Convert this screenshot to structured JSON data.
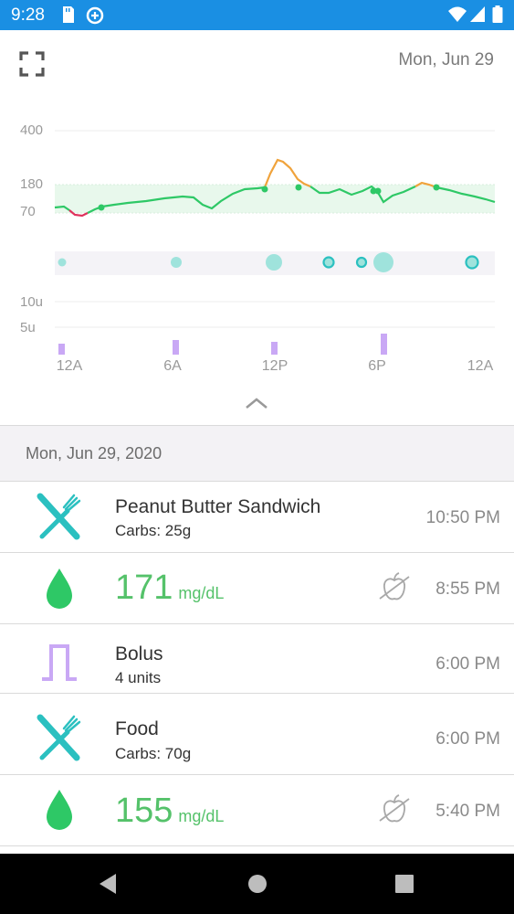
{
  "status_bar": {
    "time": "9:28",
    "icons": [
      "sd-card-icon",
      "data-saver-icon",
      "wifi-icon",
      "signal-icon",
      "battery-icon"
    ]
  },
  "header": {
    "date": "Mon, Jun 29",
    "fullscreen_icon": "fullscreen-icon"
  },
  "chart": {
    "y_labels": {
      "bg_400": "400",
      "bg_180": "180",
      "bg_70": "70",
      "insulin_10u": "10u",
      "insulin_5u": "5u"
    },
    "x_labels": [
      "12A",
      "6A",
      "12P",
      "6P",
      "12A"
    ],
    "colors": {
      "in_range": "#2ec866",
      "high": "#f0a33c",
      "low": "#e0315c",
      "carbs": "#2bc0c0",
      "bolus": "#c9a8f5",
      "target_band": "#e8f8ec"
    }
  },
  "list": {
    "section_date": "Mon, Jun 29, 2020",
    "entries": [
      {
        "type": "food",
        "icon": "fork-knife-icon",
        "title": "Peanut Butter Sandwich",
        "subtitle": "Carbs: 25g",
        "time": "10:50 PM"
      },
      {
        "type": "glucose",
        "icon": "blood-drop-icon",
        "value": "171",
        "unit": "mg/dL",
        "no_food_icon": "apple-crossed-icon",
        "time": "8:55 PM"
      },
      {
        "type": "bolus",
        "icon": "bolus-pulse-icon",
        "title": "Bolus",
        "subtitle": "4 units",
        "time": "6:00 PM"
      },
      {
        "type": "food",
        "icon": "fork-knife-icon",
        "title": "Food",
        "subtitle": "Carbs: 70g",
        "time": "6:00 PM"
      },
      {
        "type": "glucose",
        "icon": "blood-drop-icon",
        "value": "155",
        "unit": "mg/dL",
        "no_food_icon": "apple-crossed-icon",
        "time": "5:40 PM"
      }
    ]
  },
  "nav_bar": {
    "icons": [
      "back-icon",
      "home-icon",
      "recents-icon"
    ]
  }
}
